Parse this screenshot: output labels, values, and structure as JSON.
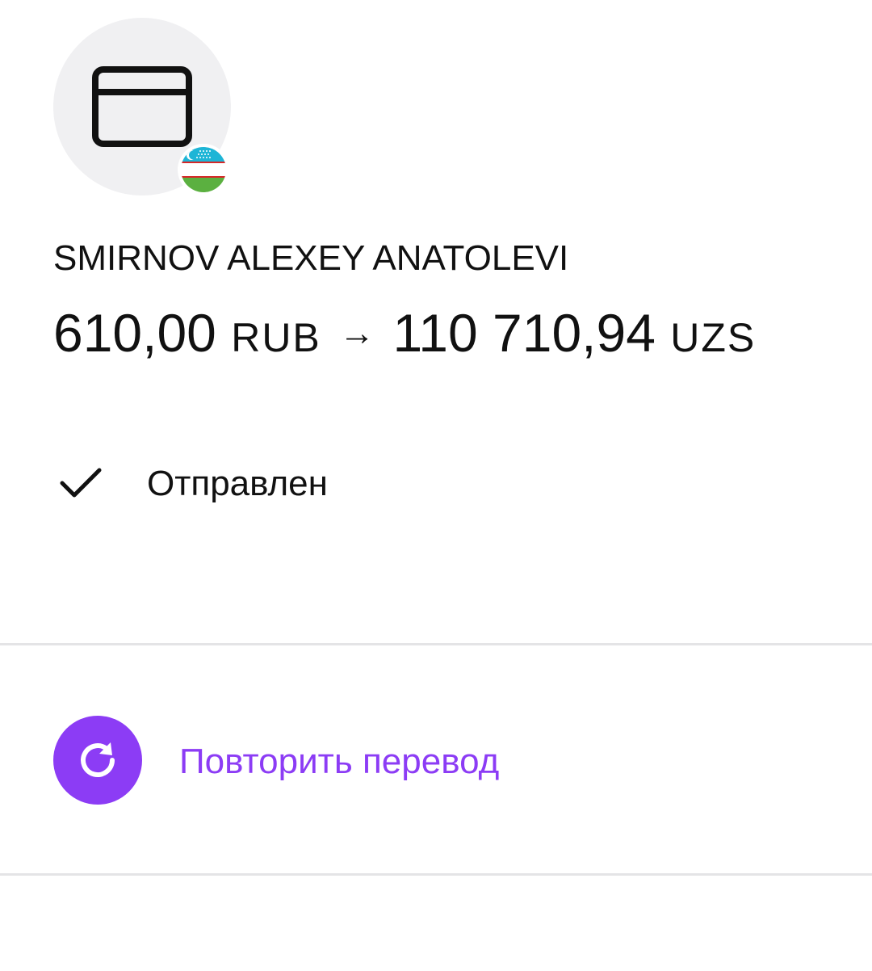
{
  "recipient": {
    "name": "SMIRNOV ALEXEY ANATOLEVI",
    "avatar_icon": "card-icon",
    "flag_icon": "uzbekistan-flag-icon"
  },
  "amount": {
    "from_value": "610,00",
    "from_currency": "RUB",
    "arrow": "→",
    "to_value": "110 710,94",
    "to_currency": "UZS"
  },
  "status": {
    "icon": "checkmark-icon",
    "label": "Отправлен"
  },
  "actions": {
    "repeat": {
      "icon": "repeat-icon",
      "label": "Повторить перевод",
      "color": "#8c3cf5"
    }
  },
  "colors": {
    "accent": "#8c3cf5",
    "avatar_bg": "#f0f0f2",
    "divider": "#e4e4e6"
  }
}
